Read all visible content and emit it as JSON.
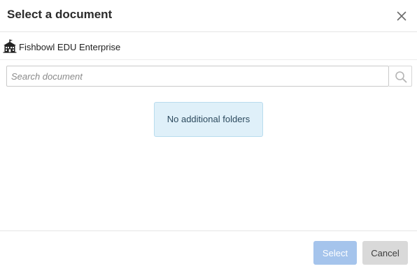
{
  "dialog": {
    "title": "Select a document"
  },
  "icons": {
    "close": "close-icon",
    "workspace": "school-building-icon",
    "search": "search-icon"
  },
  "breadcrumb": {
    "label": "Fishbowl EDU Enterprise"
  },
  "search": {
    "placeholder": "Search document",
    "value": ""
  },
  "content": {
    "empty_message": "No additional folders"
  },
  "footer": {
    "select_label": "Select",
    "cancel_label": "Cancel"
  },
  "colors": {
    "select_button": "#a5c4ec",
    "cancel_button": "#d9d9d9",
    "info_background": "#dff0f9",
    "info_border": "#b8dcee"
  }
}
